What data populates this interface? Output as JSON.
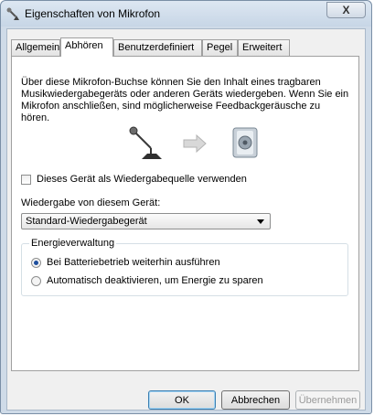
{
  "window": {
    "title": "Eigenschaften von Mikrofon",
    "close_glyph": "X"
  },
  "tabs": [
    {
      "label": "Allgemein",
      "active": false
    },
    {
      "label": "Abhören",
      "active": true
    },
    {
      "label": "Benutzerdefiniert",
      "active": false
    },
    {
      "label": "Pegel",
      "active": false
    },
    {
      "label": "Erweitert",
      "active": false
    }
  ],
  "panel": {
    "description": "Über diese Mikrofon-Buchse können Sie den Inhalt eines tragbaren Musikwiedergabegeräts oder anderen Geräts wiedergeben. Wenn Sie ein Mikrofon anschließen, sind möglicherweise Feedbackgeräusche zu hören.",
    "listen_checkbox": {
      "label": "Dieses Gerät als Wiedergabequelle verwenden",
      "checked": false
    },
    "playback_label": "Wiedergabe von diesem Gerät:",
    "playback_select_value": "Standard-Wiedergabegerät",
    "power": {
      "title": "Energieverwaltung",
      "options": [
        {
          "label": "Bei Batteriebetrieb weiterhin ausführen",
          "checked": true
        },
        {
          "label": "Automatisch deaktivieren, um Energie zu sparen",
          "checked": false
        }
      ]
    }
  },
  "buttons": {
    "ok": "OK",
    "cancel": "Abbrechen",
    "apply": "Übernehmen"
  },
  "colors": {
    "accent": "#3c7fb1",
    "titlebar": "#c7d6e6",
    "radio_dot": "#1e4f9e"
  }
}
